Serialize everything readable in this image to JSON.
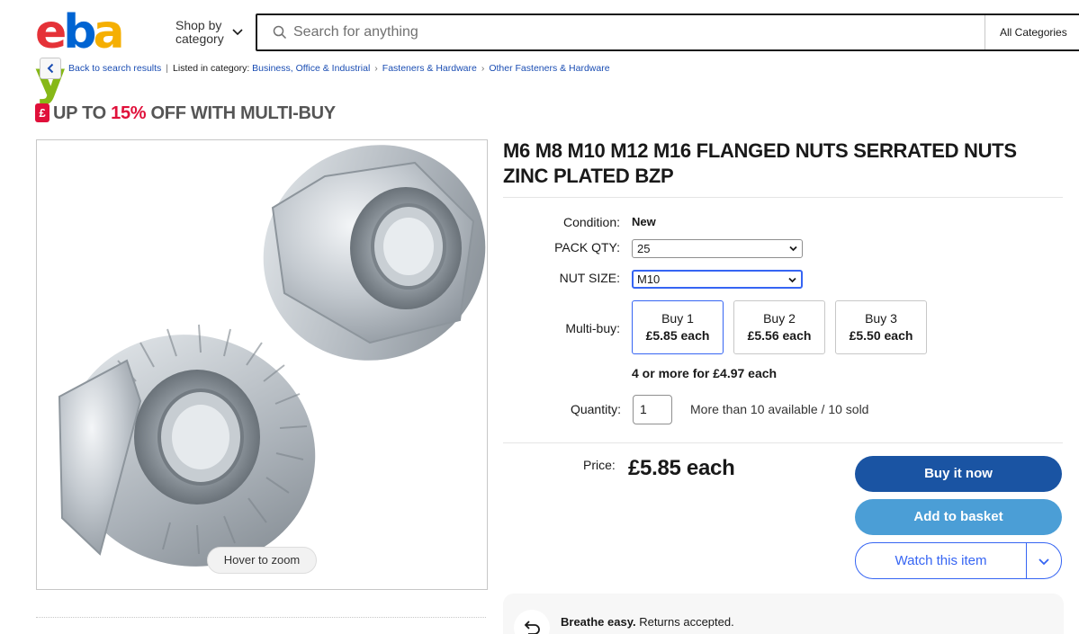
{
  "header": {
    "logo_letters": [
      "e",
      "b",
      "a",
      "y"
    ],
    "logo_colors": [
      "#e53238",
      "#0064d2",
      "#f5af02",
      "#86b817"
    ],
    "shop_by_line1": "Shop by",
    "shop_by_line2": "category",
    "search_placeholder": "Search for anything",
    "category_select": "All Categories"
  },
  "breadcrumb": {
    "back_label": "Back to search results",
    "listed_in": "Listed in category:",
    "items": [
      "Business, Office & Industrial",
      "Fasteners & Hardware",
      "Other Fasteners & Hardware"
    ]
  },
  "promo": {
    "icon": "£",
    "prefix": "UP TO ",
    "percent": "15%",
    "suffix": " OFF WITH MULTI-BUY"
  },
  "image": {
    "zoom_label": "Hover to zoom"
  },
  "listing": {
    "title": "M6 M8 M10 M12 M16 FLANGED NUTS SERRATED NUTS ZINC PLATED BZP",
    "condition_label": "Condition:",
    "condition_value": "New",
    "pack_qty_label": "PACK QTY:",
    "pack_qty_value": "25",
    "nut_size_label": "NUT SIZE:",
    "nut_size_value": "M10",
    "multibuy_label": "Multi-buy:",
    "multibuy": [
      {
        "qty": "Buy 1",
        "price": "£5.85 each"
      },
      {
        "qty": "Buy 2",
        "price": "£5.56 each"
      },
      {
        "qty": "Buy 3",
        "price": "£5.50 each"
      }
    ],
    "four_more": "4 or more for £4.97 each",
    "quantity_label": "Quantity:",
    "quantity_value": "1",
    "availability": "More than 10 available / 10 sold",
    "price_label": "Price:",
    "price_value": "£5.85 each"
  },
  "actions": {
    "buy_now": "Buy it now",
    "add_basket": "Add to basket",
    "watch": "Watch this item"
  },
  "returns": {
    "bold": "Breathe easy.",
    "text": " Returns accepted."
  }
}
